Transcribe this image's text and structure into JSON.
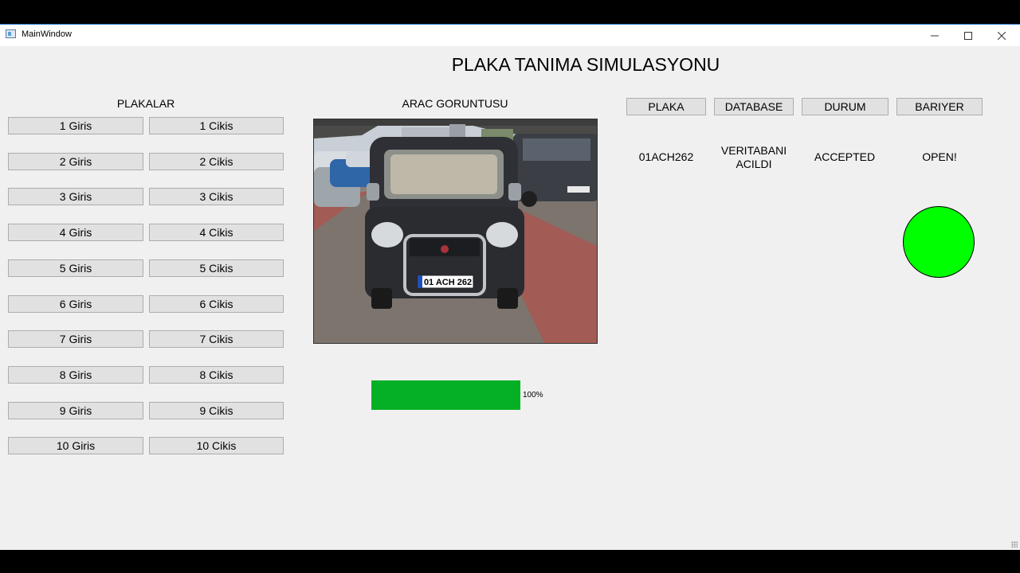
{
  "window": {
    "title": "MainWindow",
    "controls": [
      "minimize",
      "maximize",
      "close"
    ]
  },
  "heading": "PLAKA TANIMA SIMULASYONU",
  "plates": {
    "label": "PLAKALAR",
    "buttons": [
      {
        "entry": "1 Giris",
        "exit": "1 Cikis"
      },
      {
        "entry": "2 Giris",
        "exit": "2 Cikis"
      },
      {
        "entry": "3 Giris",
        "exit": "3 Cikis"
      },
      {
        "entry": "4 Giris",
        "exit": "4 Cikis"
      },
      {
        "entry": "5 Giris",
        "exit": "5 Cikis"
      },
      {
        "entry": "6 Giris",
        "exit": "6 Cikis"
      },
      {
        "entry": "7 Giris",
        "exit": "7 Cikis"
      },
      {
        "entry": "8 Giris",
        "exit": "8 Cikis"
      },
      {
        "entry": "9 Giris",
        "exit": "9 Cikis"
      },
      {
        "entry": "10 Giris",
        "exit": "10 Cikis"
      }
    ]
  },
  "vehicle_image": {
    "label": "ARAC GORUNTUSU",
    "plate_text": "01 ACH 262"
  },
  "progress": {
    "value": 1.0,
    "text": "100%",
    "color": "#06b025"
  },
  "panels": {
    "buttons": [
      "PLAKA",
      "DATABASE",
      "DURUM",
      "BARIYER"
    ],
    "values": {
      "plate": "01ACH262",
      "database_line1": "VERITABANI",
      "database_line2": "ACILDI",
      "status": "ACCEPTED",
      "barrier": "OPEN!"
    }
  },
  "barrier_light": {
    "color": "#00ff00"
  }
}
